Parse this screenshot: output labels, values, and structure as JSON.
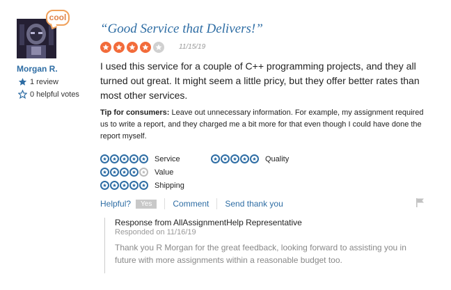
{
  "reviewer": {
    "badge": "cool",
    "name": "Morgan R.",
    "reviews": "1 review",
    "helpful_votes": "0 helpful votes"
  },
  "review": {
    "title": "“Good Service that Delivers!”",
    "rating": 4,
    "max_rating": 5,
    "date": "11/15/19",
    "body": "I used this service for a couple of C++ programming projects, and they all turned out great. It might seem a little pricy, but they offer better rates than most other services.",
    "tip_label": "Tip for consumers:",
    "tip_text": " Leave out unnecessary information. For example, my assignment required us to write a report, and they charged me a bit more for that even though I could have done the report myself."
  },
  "sub_ratings": [
    {
      "label": "Service",
      "value": 5
    },
    {
      "label": "Quality",
      "value": 5
    },
    {
      "label": "Value",
      "value": 4
    },
    {
      "label": "Shipping",
      "value": 5
    }
  ],
  "actions": {
    "helpful": "Helpful?",
    "yes": "Yes",
    "comment": "Comment",
    "send_thanks": "Send thank you"
  },
  "response": {
    "heading": "Response from AllAssignmentHelp Representative",
    "date": "Responded on 11/16/19",
    "body": "Thank you R Morgan for the great feedback, looking forward to assisting you in future with more assignments within a reasonable budget too."
  },
  "colors": {
    "accent": "#2e6da4",
    "star_on": "#f26b3a",
    "star_off": "#d0d0d0"
  }
}
